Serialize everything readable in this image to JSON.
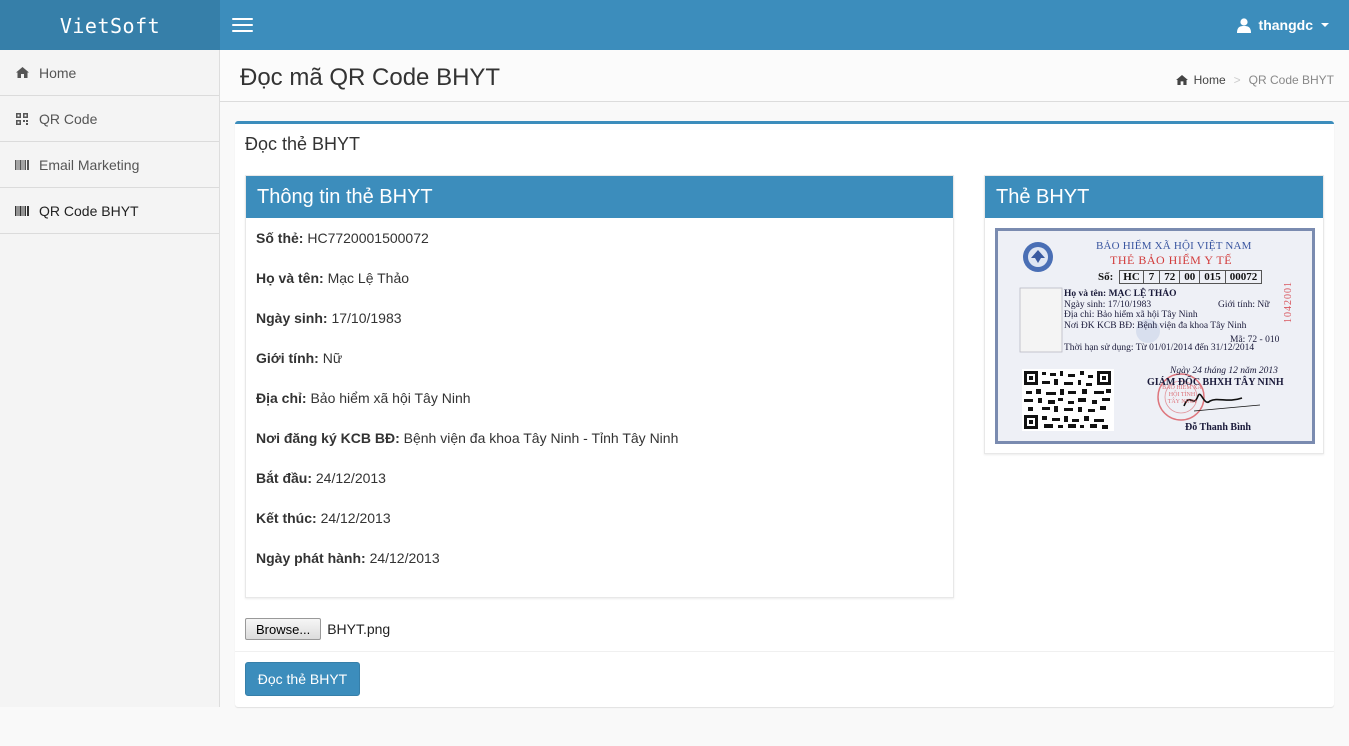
{
  "app": {
    "brand": "VietSoft"
  },
  "header": {
    "username": "thangdc"
  },
  "sidebar": {
    "items": [
      {
        "label": "Home",
        "icon": "home-icon"
      },
      {
        "label": "QR Code",
        "icon": "qrcode-icon"
      },
      {
        "label": "Email Marketing",
        "icon": "barcode-icon"
      },
      {
        "label": "QR Code BHYT",
        "icon": "barcode-icon"
      }
    ]
  },
  "page": {
    "title": "Đọc mã QR Code BHYT",
    "breadcrumb": {
      "home": "Home",
      "current": "QR Code BHYT"
    }
  },
  "box": {
    "title": "Đọc thẻ BHYT",
    "info_panel": {
      "title": "Thông tin thẻ BHYT",
      "rows": [
        {
          "label": "Số thẻ:",
          "value": "HC7720001500072"
        },
        {
          "label": "Họ và tên:",
          "value": "Mạc Lệ Thảo"
        },
        {
          "label": "Ngày sinh:",
          "value": "17/10/1983"
        },
        {
          "label": "Giới tính:",
          "value": "Nữ"
        },
        {
          "label": "Địa chỉ:",
          "value": "Bảo hiểm xã hội Tây Ninh"
        },
        {
          "label": "Nơi đăng ký KCB BĐ:",
          "value": "Bệnh viện đa khoa Tây Ninh - Tỉnh Tây Ninh"
        },
        {
          "label": "Bắt đầu:",
          "value": "24/12/2013"
        },
        {
          "label": "Kết thúc:",
          "value": "24/12/2013"
        },
        {
          "label": "Ngày phát hành:",
          "value": "24/12/2013"
        }
      ]
    },
    "card_panel": {
      "title": "Thẻ BHYT",
      "card": {
        "org": "BẢO HIỂM XÃ HỘI VIỆT NAM",
        "heading": "THẺ BẢO HIỂM Y TẾ",
        "so_label": "Số:",
        "so_parts": [
          "HC",
          "7",
          "72",
          "00",
          "015",
          "00072"
        ],
        "lines": [
          "Họ và tên: MẠC LỆ THẢO",
          "Ngày sinh: 17/10/1983",
          "Địa chỉ: Bảo hiểm xã hội Tây Ninh",
          "Nơi ĐK KCB BĐ: Bệnh viện đa khoa Tây Ninh",
          "Thời hạn sử dụng: Từ 01/01/2014 đến 31/12/2014"
        ],
        "gender": "Giới tính: Nữ",
        "ma": "Mã: 72 - 010",
        "date_signed": "Ngày 24 tháng 12 năm 2013",
        "director": "GIÁM ĐỐC BHXH TÂY NINH",
        "signer": "Đỗ Thanh Bình",
        "serial": "1042001",
        "stamp_text": "BẢO HIỂM XÃ HỘI TỈNH TÂY NINH"
      }
    },
    "upload": {
      "browse_label": "Browse...",
      "file_name": "BHYT.png"
    },
    "submit_label": "Đọc thẻ BHYT"
  }
}
